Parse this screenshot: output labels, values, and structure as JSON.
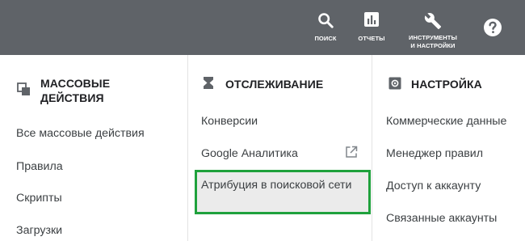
{
  "topbar": {
    "search_label": "ПОИСК",
    "reports_label": "ОТЧЕТЫ",
    "tools_label": "ИНСТРУМЕНТЫ\nИ НАСТРОЙКИ",
    "background": "#5f6368"
  },
  "bulk": {
    "title": "МАССОВЫЕ\nДЕЙСТВИЯ",
    "items": [
      "Все массовые действия",
      "Правила",
      "Скрипты",
      "Загрузки"
    ]
  },
  "tracking": {
    "title": "ОТСЛЕЖИВАНИЕ",
    "items": [
      "Конверсии",
      "Google Аналитика",
      "Атрибуция в поисковой сети"
    ]
  },
  "settings": {
    "title": "НАСТРОЙКА",
    "items": [
      "Коммерческие данные",
      "Менеджер правил",
      "Доступ к аккаунту",
      "Связанные аккаунты"
    ]
  },
  "colors": {
    "highlight_border": "#1fa13c",
    "highlight_bg": "#ebebeb",
    "text": "#3c4043"
  },
  "icons": [
    "search-icon",
    "bar-chart-icon",
    "wrench-icon",
    "help-icon",
    "copy-stack-icon",
    "hourglass-icon",
    "gear-icon",
    "external-link-icon"
  ]
}
